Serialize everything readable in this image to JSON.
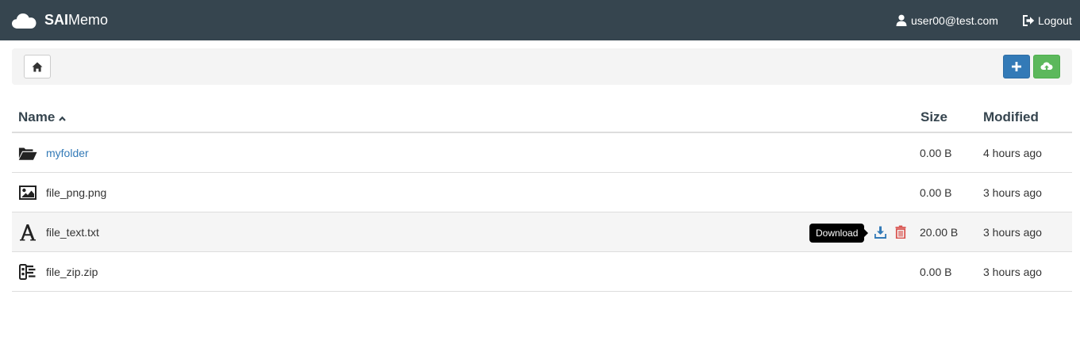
{
  "navbar": {
    "brand_bold": "SAI",
    "brand_rest": "Memo",
    "user": "user00@test.com",
    "logout": "Logout"
  },
  "toolbar": {
    "home_icon": "home-icon",
    "add_icon": "plus-icon",
    "upload_icon": "cloud-upload-icon"
  },
  "table": {
    "headers": {
      "name": "Name",
      "size": "Size",
      "modified": "Modified"
    },
    "sort": "name-ascending",
    "rows": [
      {
        "icon": "folder-open-icon",
        "name": "myfolder",
        "size": "0.00 B",
        "modified": "4 hours ago"
      },
      {
        "icon": "image-file-icon",
        "name": "file_png.png",
        "size": "0.00 B",
        "modified": "3 hours ago"
      },
      {
        "icon": "text-file-icon",
        "name": "file_text.txt",
        "size": "20.00 B",
        "modified": "3 hours ago"
      },
      {
        "icon": "archive-file-icon",
        "name": "file_zip.zip",
        "size": "0.00 B",
        "modified": "3 hours ago"
      }
    ],
    "tooltip": "Download"
  },
  "colors": {
    "navbar_bg": "#36454f",
    "link": "#337ab7",
    "add_button": "#337ab7",
    "upload_button": "#5cb85c",
    "delete_icon": "#d9534f"
  }
}
